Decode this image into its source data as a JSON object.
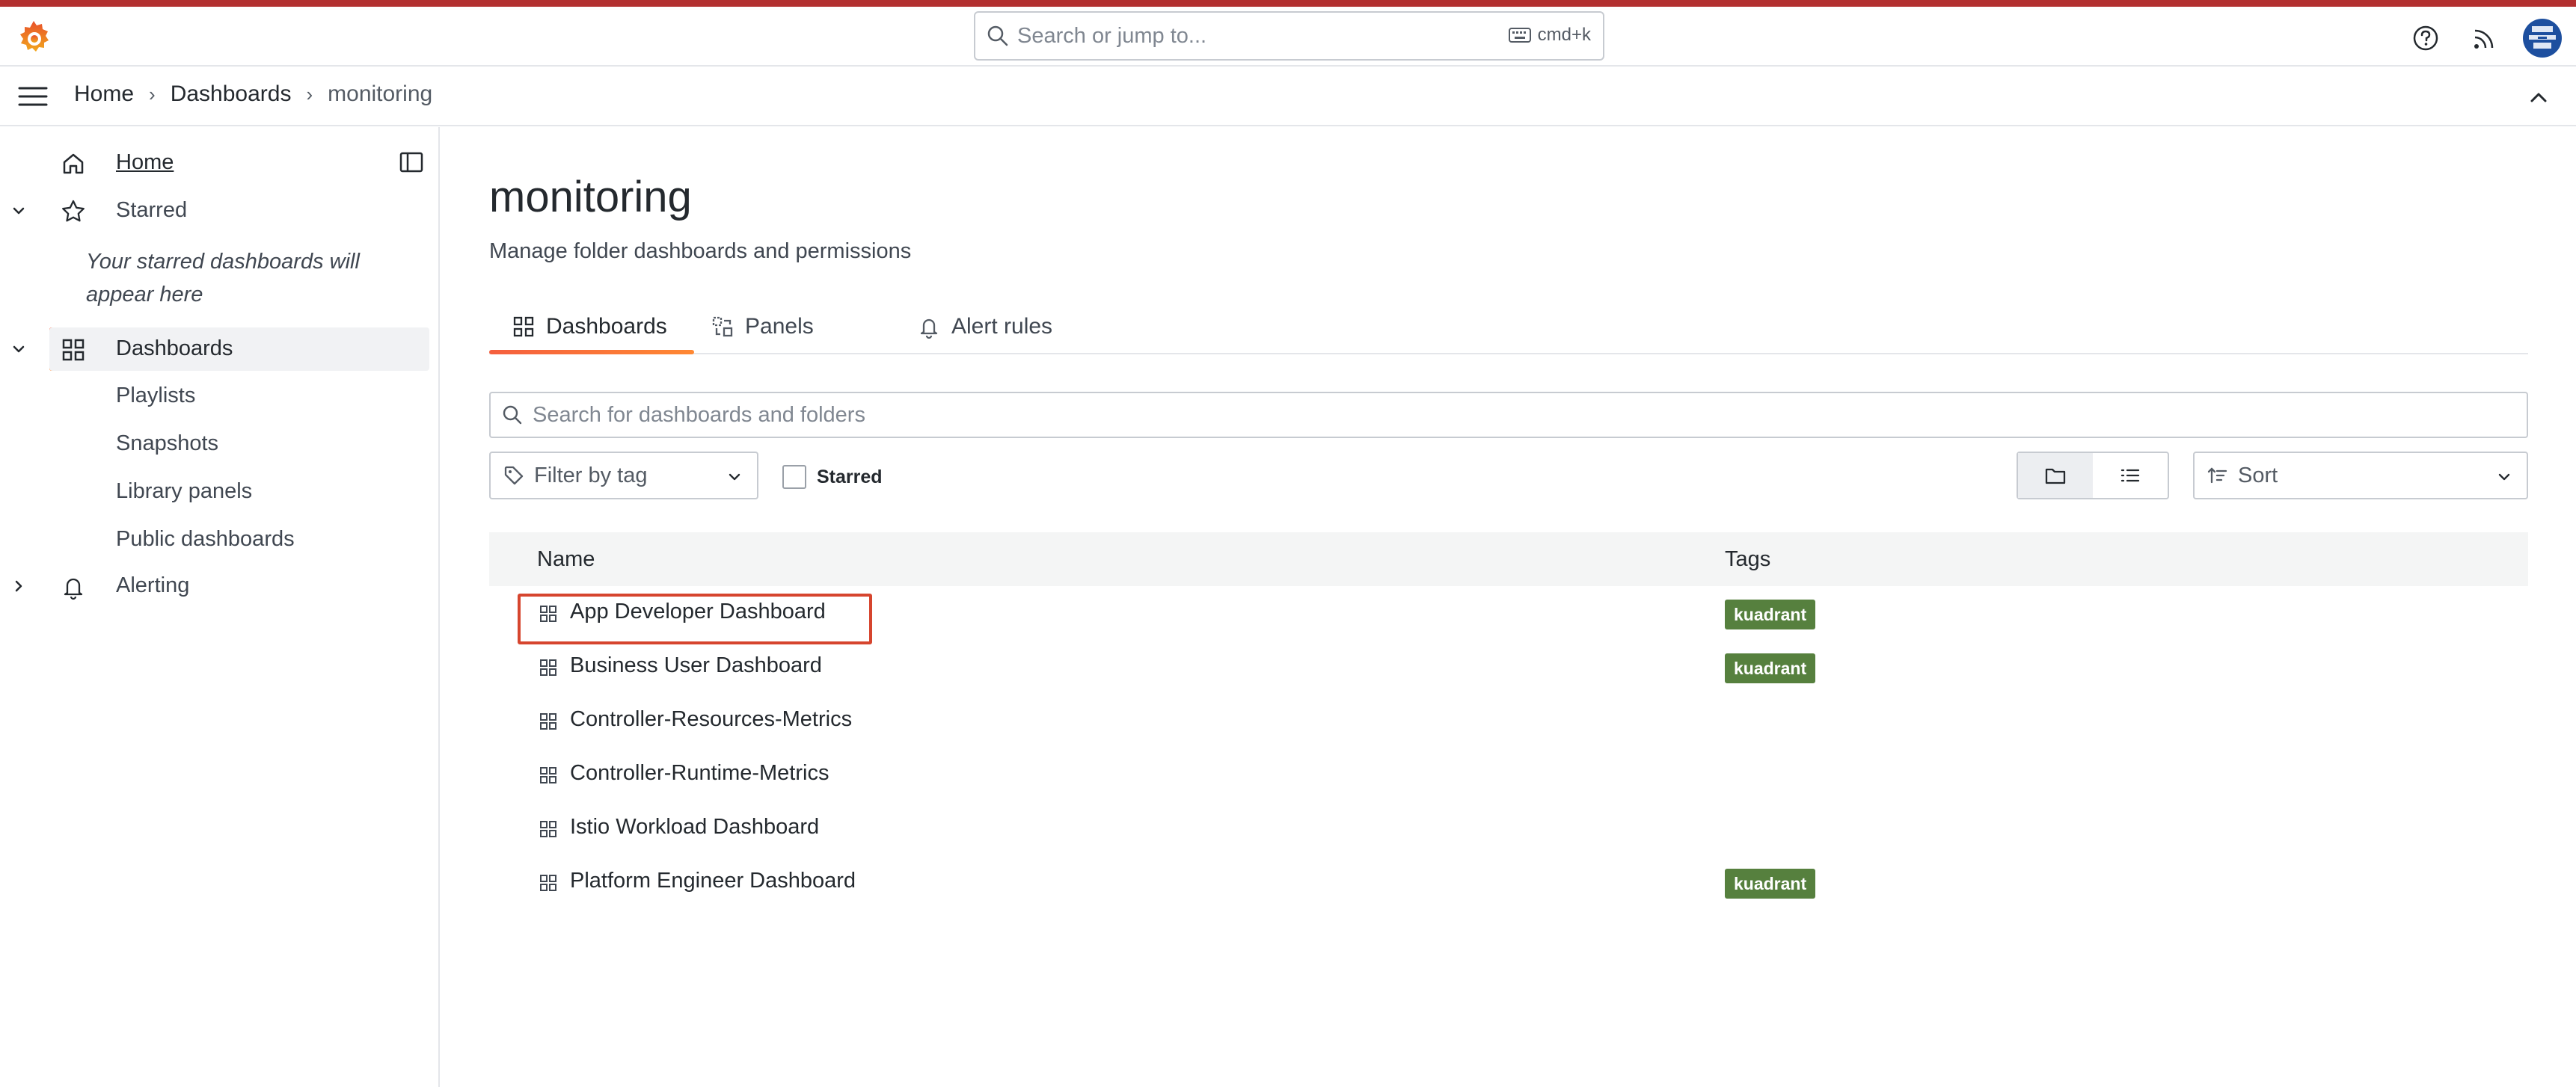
{
  "colors": {
    "accent_line": "#b33030",
    "active_gradient_start": "#f55f3e",
    "active_gradient_end": "#ff8833",
    "tag_green": "#56803e",
    "highlight_red": "#d6452e",
    "avatar_bg": "#1d4f9f"
  },
  "topbar": {
    "search_placeholder": "Search or jump to...",
    "shortcut": "cmd+k",
    "icons": [
      "grafana-logo-icon",
      "search-icon",
      "keyboard-icon",
      "help-icon",
      "news-feed-icon",
      "user-avatar"
    ]
  },
  "breadcrumb": {
    "items": [
      "Home",
      "Dashboards",
      "monitoring"
    ]
  },
  "sidebar": {
    "home": "Home",
    "starred": "Starred",
    "starred_empty": "Your starred dashboards will appear here",
    "dashboards": "Dashboards",
    "sub_items": [
      "Playlists",
      "Snapshots",
      "Library panels",
      "Public dashboards"
    ],
    "alerting": "Alerting"
  },
  "main": {
    "title": "monitoring",
    "subtitle": "Manage folder dashboards and permissions",
    "tabs": [
      {
        "label": "Dashboards",
        "active": true
      },
      {
        "label": "Panels",
        "active": false
      },
      {
        "label": "Alert rules",
        "active": false
      }
    ],
    "search_placeholder": "Search for dashboards and folders",
    "filter_by_tag": "Filter by tag",
    "starred_label": "Starred",
    "sort_label": "Sort",
    "view_mode": "folder"
  },
  "table": {
    "columns": [
      "Name",
      "Tags"
    ],
    "rows": [
      {
        "name": "App Developer Dashboard",
        "tag": "kuadrant"
      },
      {
        "name": "Business User Dashboard",
        "tag": "kuadrant"
      },
      {
        "name": "Controller-Resources-Metrics",
        "tag": ""
      },
      {
        "name": "Controller-Runtime-Metrics",
        "tag": ""
      },
      {
        "name": "Istio Workload Dashboard",
        "tag": ""
      },
      {
        "name": "Platform Engineer Dashboard",
        "tag": "kuadrant"
      }
    ]
  }
}
